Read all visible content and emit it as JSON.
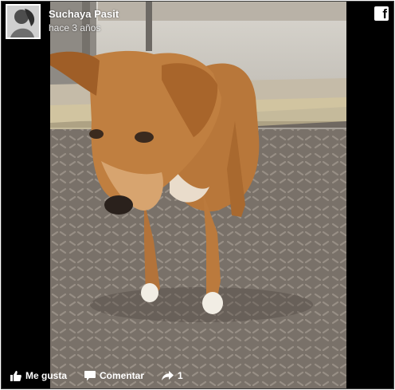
{
  "post": {
    "author": "Suchaya Pasit",
    "timestamp": "hace 3 años"
  },
  "actions": {
    "like_label": "Me gusta",
    "comment_label": "Comentar",
    "share_count": "1"
  },
  "icons": {
    "platform": "facebook-icon",
    "like": "thumbs-up-icon",
    "comment": "speech-bubble-icon",
    "share": "share-arrow-icon"
  },
  "colors": {
    "background": "#000000",
    "text": "#ffffff"
  }
}
